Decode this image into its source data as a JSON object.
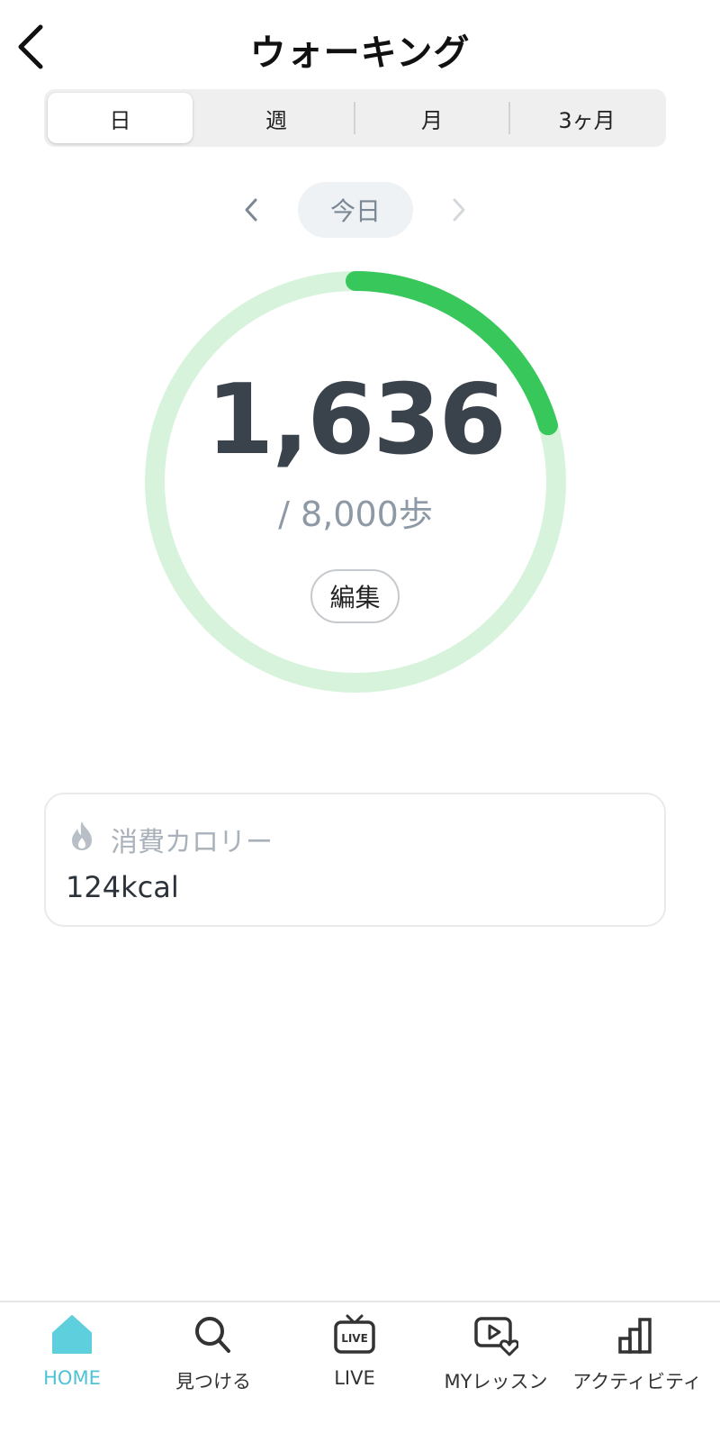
{
  "header": {
    "title": "ウォーキング"
  },
  "period_tabs": [
    {
      "label": "日",
      "active": true
    },
    {
      "label": "週",
      "active": false
    },
    {
      "label": "月",
      "active": false
    },
    {
      "label": "3ヶ月",
      "active": false
    }
  ],
  "date_nav": {
    "current": "今日"
  },
  "progress": {
    "steps": "1,636",
    "goal_text": "/ 8,000歩",
    "fraction": 0.2045,
    "edit_label": "編集",
    "track_color": "#d8f3dc",
    "fill_color": "#37c75a"
  },
  "calories": {
    "label": "消費カロリー",
    "value": "124kcal",
    "icon": "flame-icon"
  },
  "tabbar": {
    "active_color": "#4fc3d6",
    "items": [
      {
        "label": "HOME",
        "icon": "home-icon"
      },
      {
        "label": "見つける",
        "icon": "search-icon"
      },
      {
        "label": "LIVE",
        "icon": "live-tv-icon"
      },
      {
        "label": "MYレッスン",
        "icon": "my-lesson-icon"
      },
      {
        "label": "アクティビティ",
        "icon": "activity-chart-icon"
      }
    ]
  }
}
